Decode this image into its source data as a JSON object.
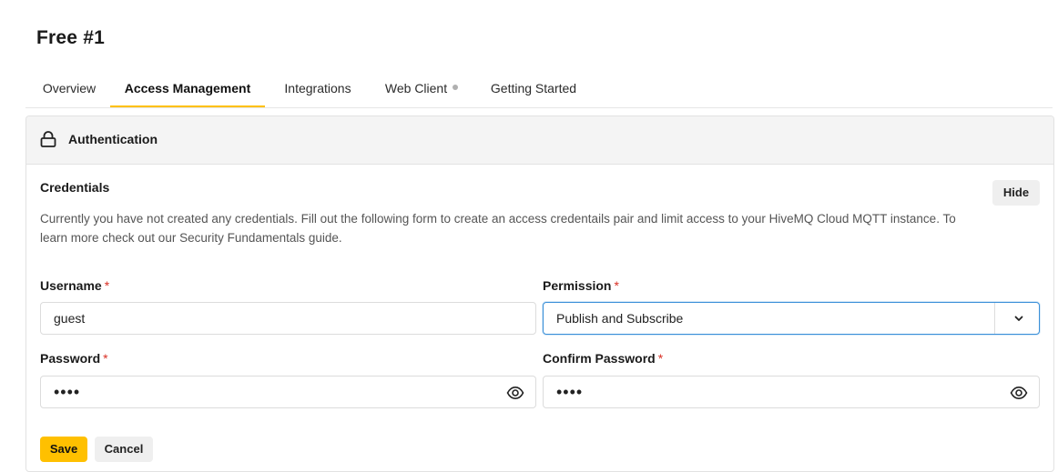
{
  "page": {
    "title": "Free #1"
  },
  "tabs": [
    {
      "label": "Overview",
      "active": false
    },
    {
      "label": "Access Management",
      "active": true
    },
    {
      "label": "Integrations",
      "active": false
    },
    {
      "label": "Web Client",
      "active": false,
      "status_dot": true
    },
    {
      "label": "Getting Started",
      "active": false
    }
  ],
  "authentication": {
    "header_title": "Authentication",
    "header_icon": "lock-icon",
    "credentials_label": "Credentials",
    "hide_label": "Hide",
    "description": "Currently you have not created any credentials. Fill out the following form to create an access credentails pair and limit access to your HiveMQ Cloud MQTT instance. To learn more check out our Security Fundamentals guide."
  },
  "form": {
    "required_mark": "*",
    "username": {
      "label": "Username",
      "value": "guest"
    },
    "permission": {
      "label": "Permission",
      "selected": "Publish and Subscribe",
      "icon": "chevron-down-icon"
    },
    "password": {
      "label": "Password",
      "masked_value": "••••",
      "icon": "eye-icon"
    },
    "confirm_password": {
      "label": "Confirm Password",
      "masked_value": "••••",
      "icon": "eye-icon"
    },
    "save_label": "Save",
    "cancel_label": "Cancel"
  },
  "colors": {
    "accent": "#ffc000",
    "required": "#d93025",
    "focus_border": "#3a8fd8"
  }
}
